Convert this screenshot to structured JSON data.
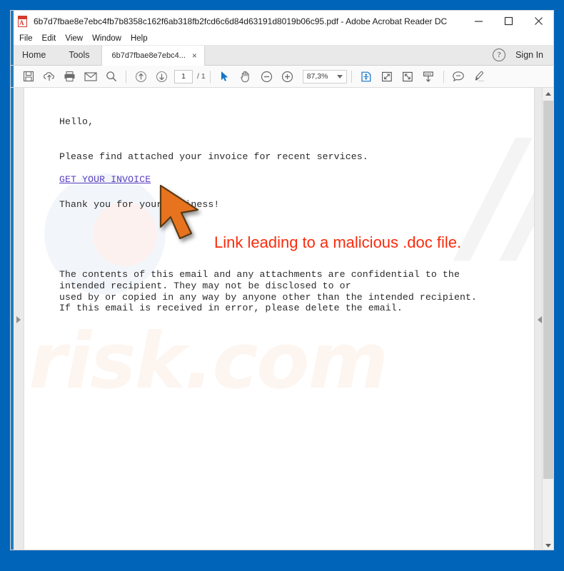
{
  "window": {
    "title": "6b7d7fbae8e7ebc4fb7b8358c162f6ab318fb2fcd6c6d84d63191d8019b06c95.pdf - Adobe Acrobat Reader DC",
    "minimize_label": "minimize-icon",
    "maximize_label": "maximize-icon",
    "close_label": "close-icon",
    "frame_color": "#0064b8"
  },
  "menubar": {
    "items": [
      {
        "label": "File"
      },
      {
        "label": "Edit"
      },
      {
        "label": "View"
      },
      {
        "label": "Window"
      },
      {
        "label": "Help"
      }
    ]
  },
  "tabs": {
    "home_label": "Home",
    "tools_label": "Tools",
    "document_label": "6b7d7fbae8e7ebc4...",
    "document_close": "×",
    "help_glyph": "?",
    "signin_label": "Sign In"
  },
  "toolbar": {
    "icons": [
      {
        "name": "save-icon"
      },
      {
        "name": "cloud-upload-icon"
      },
      {
        "name": "print-icon"
      },
      {
        "name": "email-icon"
      },
      {
        "name": "search-icon"
      },
      {
        "name": "previous-page-icon"
      },
      {
        "name": "next-page-icon"
      }
    ],
    "page_number": "1",
    "page_count": "/ 1",
    "zoom_level": "87,3%",
    "right_icons": [
      {
        "name": "fit-page-icon"
      },
      {
        "name": "fit-width-icon"
      },
      {
        "name": "full-screen-icon"
      },
      {
        "name": "scroll-down-icon"
      },
      {
        "name": "comment-icon"
      },
      {
        "name": "highlight-icon"
      }
    ]
  },
  "document": {
    "greeting": "Hello,",
    "intro": "Please find attached your invoice for recent services.",
    "link_text": "GET YOUR INVOICE",
    "link_color": "#5a3fbf",
    "thanks": "Thank you for your business!",
    "disclaimer": "The contents of this email and any attachments are confidential to the\nintended recipient. They may not be disclosed to or\nused by or copied in any way by anyone other than the intended recipient.\nIf this email is received in error, please delete the email.",
    "watermark_text": "risk.com"
  },
  "annotation": {
    "text": "Link leading to a malicious .doc file.",
    "color": "#fa2b0c",
    "arrow_color": "#e8731f"
  },
  "panels": {
    "left_arrow": "right-chevron-icon",
    "right_arrow": "left-chevron-icon"
  }
}
